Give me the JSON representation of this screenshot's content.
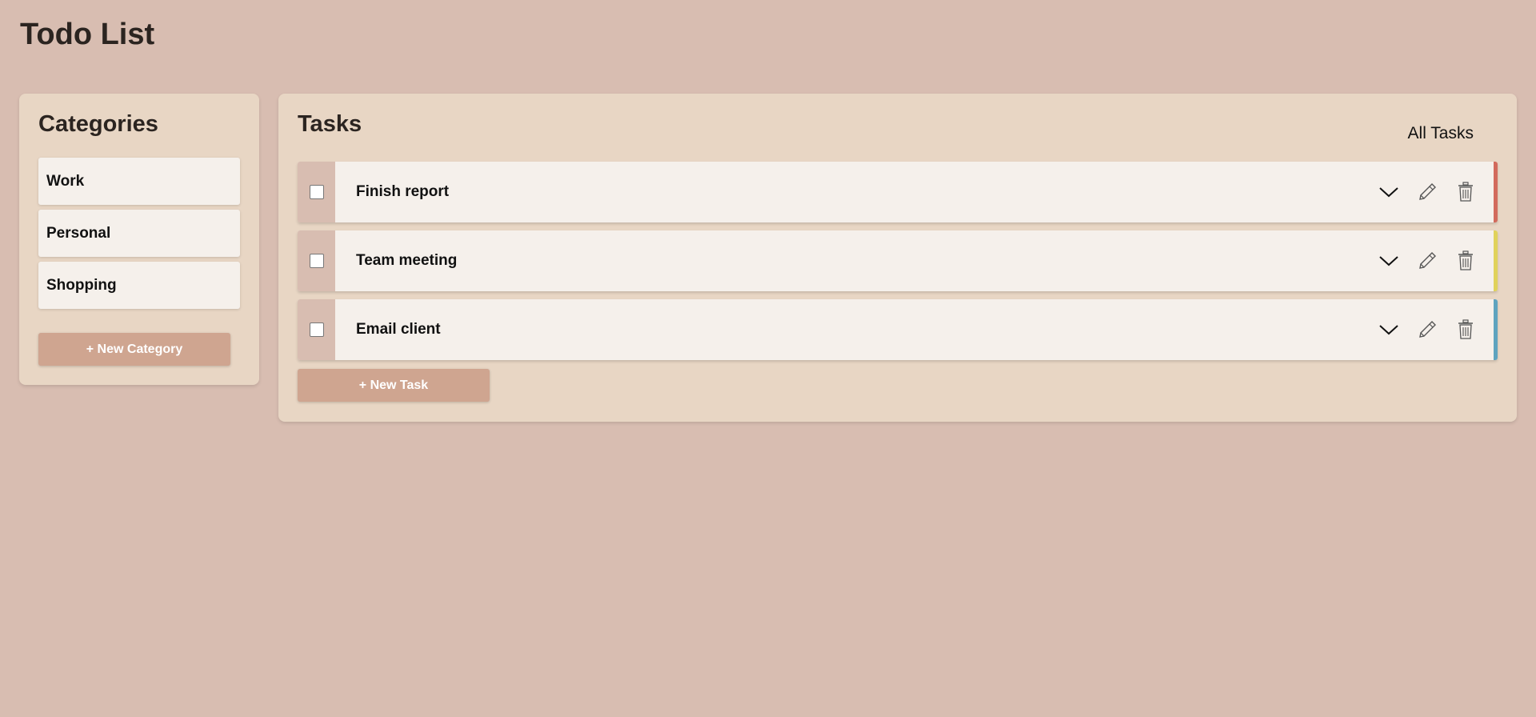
{
  "app": {
    "title": "Todo List"
  },
  "categories": {
    "title": "Categories",
    "items": [
      {
        "label": "Work"
      },
      {
        "label": "Personal"
      },
      {
        "label": "Shopping"
      }
    ],
    "new_button": "+ New Category"
  },
  "tasks": {
    "title": "Tasks",
    "filter": "All Tasks",
    "items": [
      {
        "title": "Finish report",
        "priority_color": "#d26a5c",
        "checked": false
      },
      {
        "title": "Team meeting",
        "priority_color": "#e0d25a",
        "checked": false
      },
      {
        "title": "Email client",
        "priority_color": "#5ea3bf",
        "checked": false
      }
    ],
    "new_button": "+ New Task"
  },
  "icons": {
    "expand": "chevron-down-icon",
    "edit": "pencil-icon",
    "delete": "trash-icon"
  },
  "colors": {
    "background": "#d8bdb1",
    "panel": "#e8d6c4",
    "card": "#f5f0eb",
    "button": "#cfa590"
  }
}
